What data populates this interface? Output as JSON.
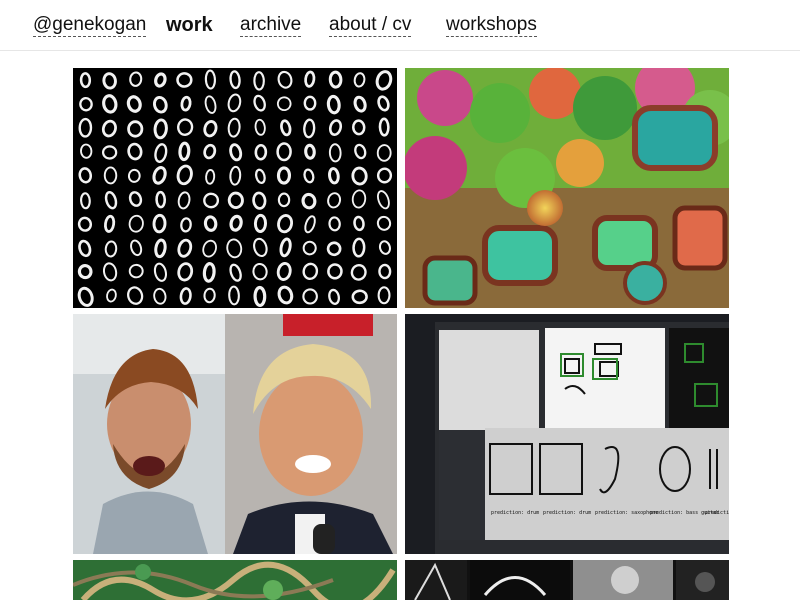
{
  "nav": {
    "home": "@genekogan",
    "work": "work",
    "archive": "archive",
    "about": "about / cv",
    "workshops": "workshops"
  },
  "tiles": [
    {
      "name": "mnist-zeros-grid",
      "icon": "handwritten-digit-grid"
    },
    {
      "name": "deepdream-landscape",
      "icon": "psychedelic-landscape"
    },
    {
      "name": "face-swap-video",
      "icon": "face-pair"
    },
    {
      "name": "doodle-classifier-screen",
      "icon": "drawing-app-screen"
    },
    {
      "name": "neural-texture",
      "icon": "green-texture"
    },
    {
      "name": "monochrome-video-frames",
      "icon": "video-strip"
    }
  ],
  "screen_panel": {
    "captions": [
      "prediction: drum",
      "prediction: drum",
      "prediction: saxophone",
      "prediction: bass guitar",
      "prediction"
    ]
  }
}
